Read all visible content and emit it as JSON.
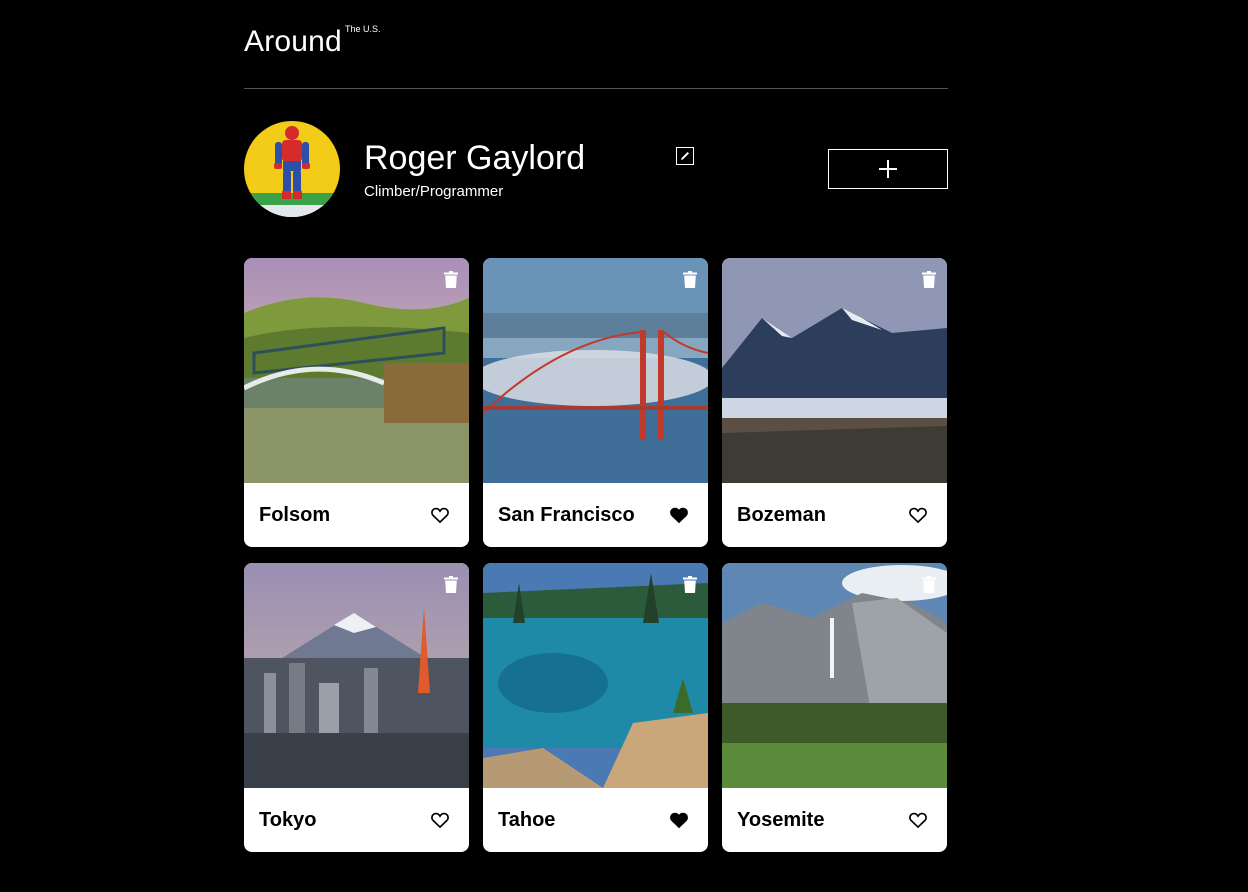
{
  "header": {
    "logo_main": "Around",
    "logo_superscript": "The U.S."
  },
  "profile": {
    "name": "Roger Gaylord",
    "job": "Climber/Programmer",
    "edit_icon": "pencil-icon",
    "add_icon": "plus-icon"
  },
  "cards": [
    {
      "title": "Folsom",
      "liked": false
    },
    {
      "title": "San Francisco",
      "liked": true
    },
    {
      "title": "Bozeman",
      "liked": false
    },
    {
      "title": "Tokyo",
      "liked": false
    },
    {
      "title": "Tahoe",
      "liked": true
    },
    {
      "title": "Yosemite",
      "liked": false
    }
  ],
  "icons": {
    "delete": "trash-icon",
    "like": "heart-icon"
  },
  "colors": {
    "background": "#000000",
    "text": "#ffffff",
    "card": "#ffffff",
    "card_text": "#000000",
    "divider": "#545454"
  }
}
